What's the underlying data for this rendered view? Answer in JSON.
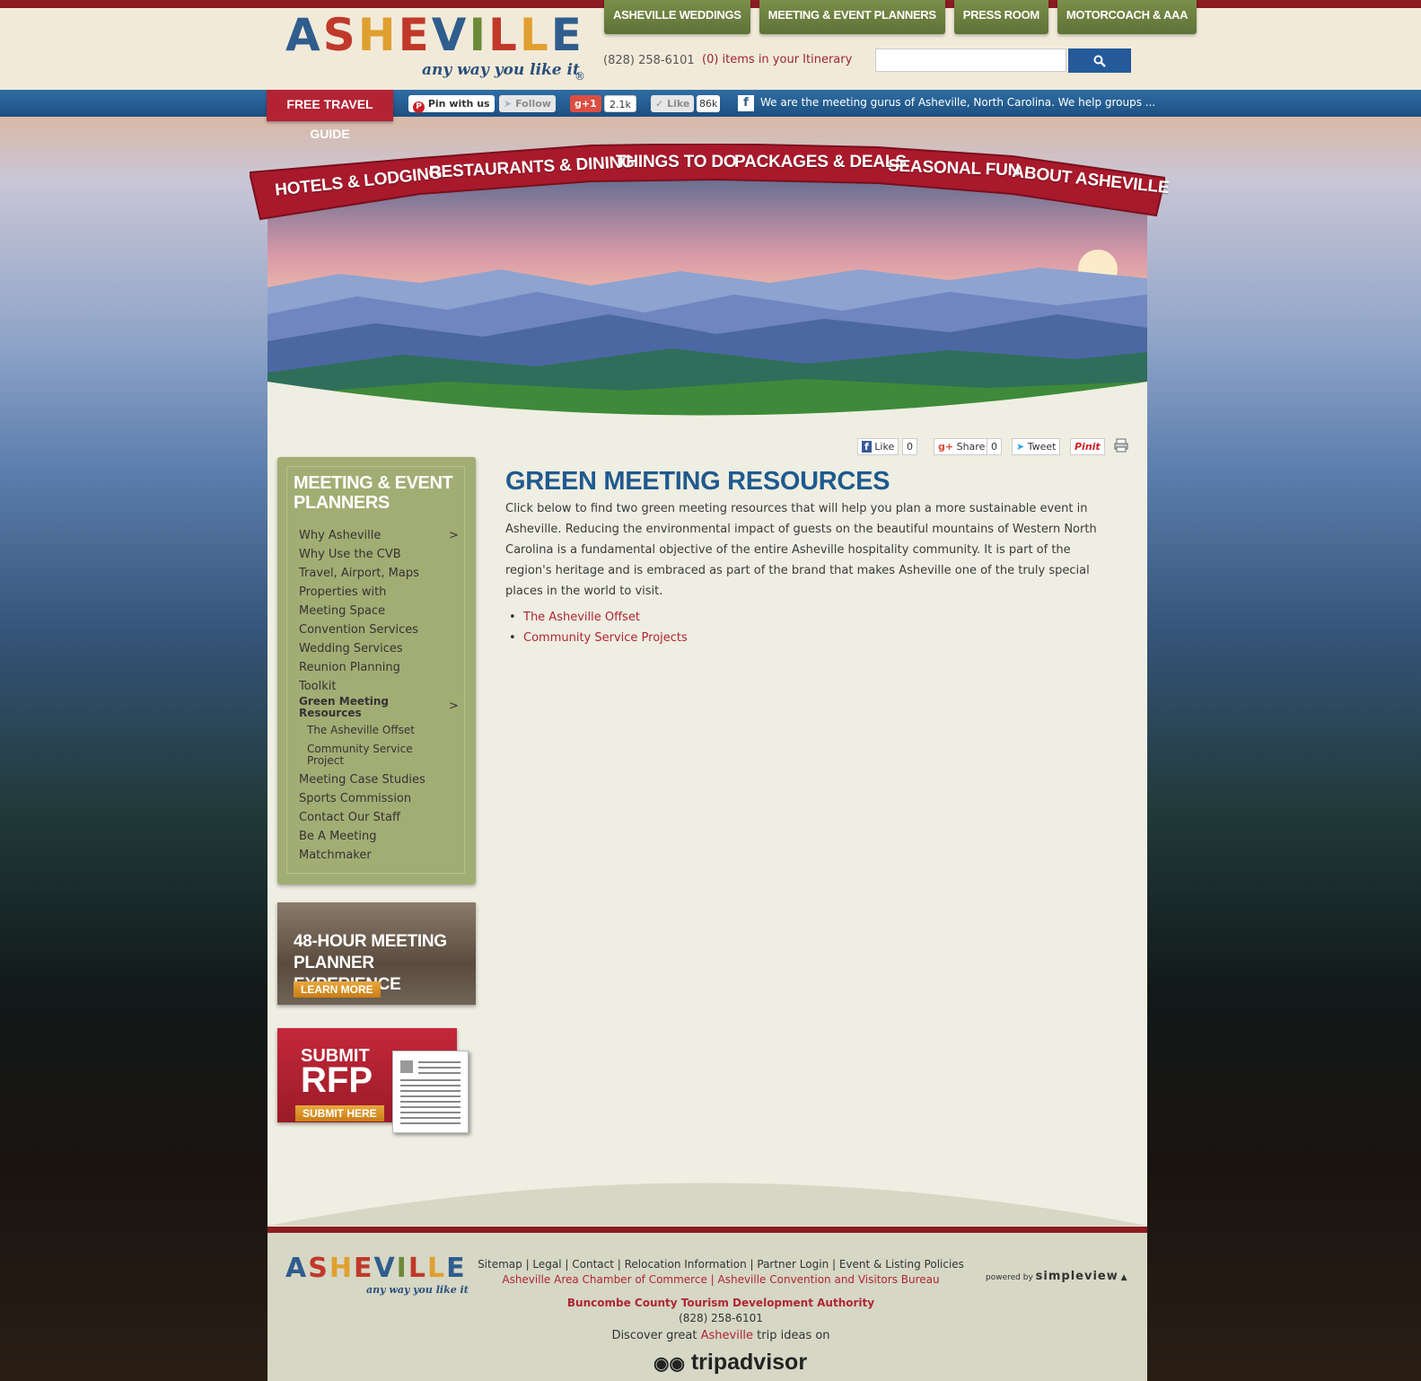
{
  "brand": {
    "logo_text": "ASHEVILLE",
    "tagline": "any way you like it",
    "reg": "®"
  },
  "top_tabs": [
    "ASHEVILLE WEDDINGS",
    "MEETING & EVENT PLANNERS",
    "PRESS ROOM",
    "MOTORCOACH & AAA"
  ],
  "header": {
    "phone": "(828) 258-6101",
    "itinerary": "(0) items in your Itinerary",
    "search_placeholder": "",
    "search_icon": "search-icon"
  },
  "social_bar": {
    "travel_guide": "FREE TRAVEL GUIDE",
    "pin": "Pin with us",
    "follow": "Follow",
    "gplus": "g+1",
    "gplus_count": "2.1k",
    "like": "Like",
    "like_count": "86k",
    "fb_status": "We are the meeting gurus of Asheville, North Carolina. We help groups ..."
  },
  "main_nav": [
    "HOTELS & LODGING",
    "RESTAURANTS & DINING",
    "THINGS TO DO",
    "PACKAGES & DEALS",
    "SEASONAL FUN",
    "ABOUT ASHEVILLE"
  ],
  "share": {
    "like": "Like",
    "like_count": "0",
    "share": "Share",
    "share_count": "0",
    "tweet": "Tweet",
    "pin": "Pinit",
    "print_icon": "print-icon"
  },
  "sidebar": {
    "title": "MEETING & EVENT PLANNERS",
    "items": [
      "Why Asheville",
      "Why Use the CVB",
      "Travel, Airport, Maps",
      "Properties with",
      "Meeting Space",
      "Convention Services",
      "Wedding Services",
      "Reunion Planning",
      "Toolkit",
      "Green Meeting Resources",
      "The Asheville Offset",
      "Community Service Project",
      "Meeting Case Studies",
      "Sports Commission",
      "Contact Our Staff",
      "Be A Meeting",
      "Matchmaker"
    ],
    "arrow": ">"
  },
  "promos": {
    "p1_title_l1": "48-HOUR MEETING",
    "p1_title_l2": "PLANNER EXPERIENCE",
    "p1_btn": "LEARN MORE",
    "p2_small": "SUBMIT",
    "p2_big": "RFP",
    "p2_btn": "SUBMIT HERE"
  },
  "main": {
    "title": "GREEN MEETING RESOURCES",
    "intro": "Click below to find two green meeting resources that will help you plan a more sustainable event in Asheville. Reducing the environmental impact of guests on the beautiful mountains of Western North Carolina is a fundamental objective of the entire Asheville hospitality community. It is part of the region's heritage and is embraced as part of the brand that makes Asheville one of the truly special places in the world to visit.",
    "links": [
      "The Asheville Offset",
      "Community Service Projects"
    ]
  },
  "footer": {
    "links": "Sitemap | Legal | Contact | Relocation Information | Partner Login | Event & Listing Policies",
    "links2": "Asheville Area Chamber of Commerce |  Asheville Convention and Visitors Bureau",
    "authority": "Buncombe County Tourism Development Authority",
    "phone": "(828) 258-6101",
    "discover_pre": "Discover great ",
    "discover_link": "Asheville",
    "discover_post": " trip ideas on",
    "tripadvisor": "tripadvisor",
    "powered": "powered by",
    "simpleview": "simpleview"
  },
  "colors": {
    "accent_red": "#8a1c22",
    "link_red": "#b02535",
    "title_blue": "#1f5a8e",
    "sidebar_green": "#a2ad74"
  }
}
